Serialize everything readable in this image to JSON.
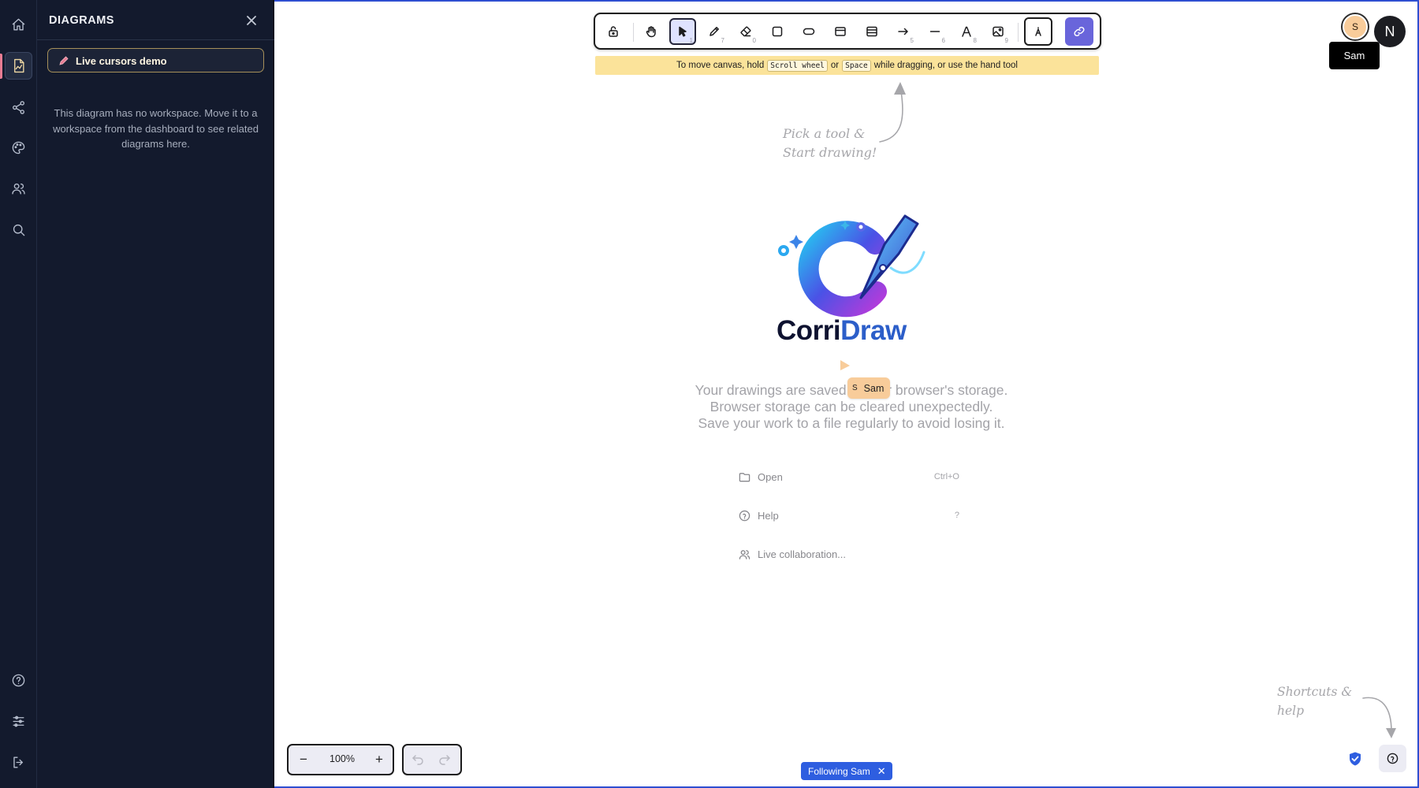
{
  "sidebar": {
    "title": "DIAGRAMS",
    "active_diagram": "Live cursors demo",
    "note": "This diagram has no workspace. Move it to a workspace from the dashboard to see related diagrams here.",
    "rail_icons": [
      "home-icon",
      "diagram-icon",
      "share-icon",
      "palette-icon",
      "users-icon",
      "search-icon",
      "help-icon",
      "settings-icon",
      "logout-icon"
    ]
  },
  "toolbar": {
    "tools": [
      {
        "name": "lock-tool",
        "key": ""
      },
      {
        "name": "hand-tool",
        "key": ""
      },
      {
        "name": "selection-tool",
        "key": "1",
        "selected": true
      },
      {
        "name": "draw-tool",
        "key": "7"
      },
      {
        "name": "eraser-tool",
        "key": "0"
      },
      {
        "name": "rectangle-tool",
        "key": ""
      },
      {
        "name": "ellipse-tool",
        "key": ""
      },
      {
        "name": "frame-tool",
        "key": ""
      },
      {
        "name": "table-tool",
        "key": ""
      },
      {
        "name": "arrow-tool",
        "key": "5"
      },
      {
        "name": "line-tool",
        "key": "6"
      },
      {
        "name": "text-tool",
        "key": "8"
      },
      {
        "name": "image-tool",
        "key": "9"
      }
    ],
    "hint": {
      "before": "To move canvas, hold",
      "key1": "Scroll wheel",
      "mid": "or",
      "key2": "Space",
      "after": "while dragging, or use the hand tool"
    }
  },
  "collab": {
    "avatar_s": "S",
    "avatar_n": "N",
    "tooltip": "Sam",
    "cursor_initial": "S",
    "cursor_name": "Sam",
    "following_label": "Following Sam"
  },
  "canvas": {
    "tool_hint_line1": "Pick a tool &",
    "tool_hint_line2": "Start drawing!",
    "help_hint_line1": "Shortcuts &",
    "help_hint_line2": "help",
    "logo_part1": "Corri",
    "logo_part2": "Draw",
    "saved_line1": "Your drawings are saved in your browser's storage.",
    "saved_line2": "Browser storage can be cleared unexpectedly.",
    "saved_line3": "Save your work to a file regularly to avoid losing it."
  },
  "menu": {
    "open_label": "Open",
    "open_shortcut": "Ctrl+O",
    "help_label": "Help",
    "help_shortcut": "?",
    "collab_label": "Live collaboration..."
  },
  "footer": {
    "zoom": "100%",
    "zoom_out": "−",
    "zoom_in": "+"
  },
  "colors": {
    "sidebar_bg": "#131a2d",
    "accent": "#6965db",
    "hint_bg": "#fbe39a",
    "follow_bg": "#2e5ee0",
    "collaborator": "#f8cc9a"
  }
}
